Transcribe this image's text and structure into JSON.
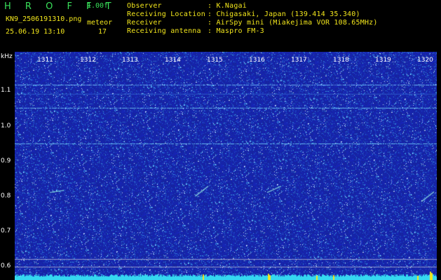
{
  "header": {
    "brand": "H R O F F T",
    "version": "1.00f",
    "filename": "KN9_2506191310.png",
    "mode_label": "meteor",
    "datetime": "25.06.19 13:10",
    "count": "17",
    "info_labels": [
      "Observer",
      "Receiving Location",
      "Receiver",
      "Receiving antenna"
    ],
    "info_values": [
      ": K.Nagai",
      ": Chigasaki, Japan (139.414 35.340)",
      ": AirSpy mini (Miakejima VOR 108.65MHz)",
      ": Maspro FM-3"
    ]
  },
  "axis": {
    "unit": "kHz",
    "y_ticks": [
      "1.1",
      "1.0",
      "0.9",
      "0.8",
      "0.7",
      "0.6"
    ],
    "x_ticks": [
      "1311",
      "1312",
      "1313",
      "1314",
      "1315",
      "1316",
      "1317",
      "1318",
      "1319",
      "1320"
    ]
  },
  "colors": {
    "background": "#000000",
    "spectrum_base": "#1c2f9e",
    "text_green": "#39e05a",
    "text_yellow": "#f2e61c",
    "baseline_cyan": "#35d8f0"
  }
}
